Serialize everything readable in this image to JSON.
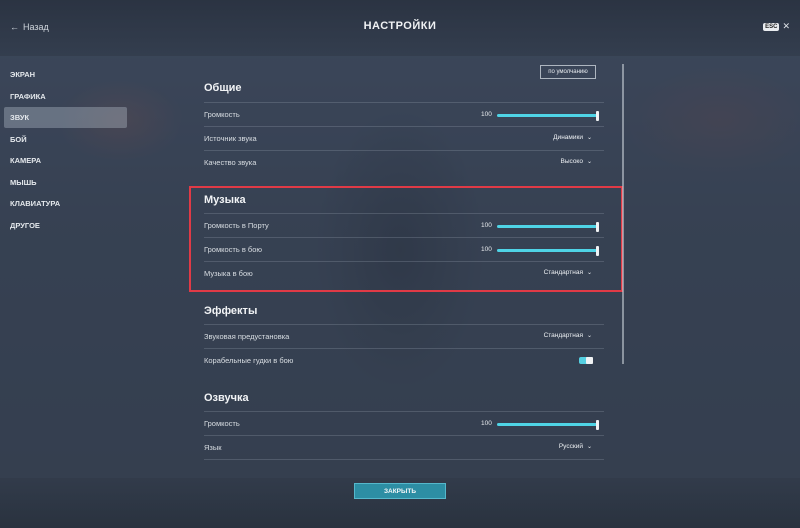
{
  "header": {
    "back_label": "Назад",
    "title": "НАСТРОЙКИ",
    "esc_key": "ESC"
  },
  "nav": {
    "items": [
      {
        "label": "ЭКРАН",
        "active": false
      },
      {
        "label": "ГРАФИКА",
        "active": false
      },
      {
        "label": "ЗВУК",
        "active": true
      },
      {
        "label": "БОЙ",
        "active": false
      },
      {
        "label": "КАМЕРА",
        "active": false
      },
      {
        "label": "МЫШЬ",
        "active": false
      },
      {
        "label": "КЛАВИАТУРА",
        "active": false
      },
      {
        "label": "ДРУГОЕ",
        "active": false
      }
    ]
  },
  "defaults_button": "по умолчанию",
  "sections": {
    "general": {
      "title": "Общие",
      "volume": {
        "label": "Громкость",
        "value": "100",
        "level": 1.0
      },
      "source": {
        "label": "Источник звука",
        "value": "Динамики"
      },
      "quality": {
        "label": "Качество звука",
        "value": "Высоко"
      }
    },
    "music": {
      "title": "Музыка",
      "port_volume": {
        "label": "Громкость в Порту",
        "value": "100",
        "level": 1.0
      },
      "battle_volume": {
        "label": "Громкость в бою",
        "value": "100",
        "level": 1.0
      },
      "battle_music": {
        "label": "Музыка в бою",
        "value": "Стандартная"
      }
    },
    "effects": {
      "title": "Эффекты",
      "preset": {
        "label": "Звуковая предустановка",
        "value": "Стандартная"
      },
      "horns": {
        "label": "Корабельные гудки в бою",
        "enabled": true
      }
    },
    "voice": {
      "title": "Озвучка",
      "volume": {
        "label": "Громкость",
        "value": "100",
        "level": 1.0
      },
      "language": {
        "label": "Язык",
        "value": "Русский"
      }
    }
  },
  "footer": {
    "close_label": "ЗАКРЫТЬ"
  },
  "colors": {
    "accent": "#4fd4e6",
    "highlight": "#e03a46",
    "close_button": "#2d8ea4"
  },
  "icons": {
    "back": "arrow-left-icon",
    "dropdown": "chevron-down-icon",
    "close": "close-icon"
  }
}
